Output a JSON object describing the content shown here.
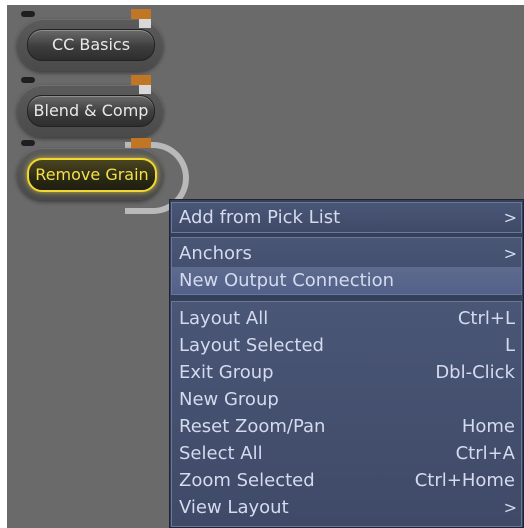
{
  "nodes": [
    {
      "label": "CC Basics",
      "selected": false
    },
    {
      "label": "Blend & Comp",
      "selected": false
    },
    {
      "label": "Remove Grain",
      "selected": true
    }
  ],
  "colors": {
    "canvas": "#6a6a6a",
    "menu_bg": "#343f5a",
    "menu_text": "#d4dbee",
    "selection_yellow": "#f1d834",
    "node_orange": "#c07624"
  },
  "menu": {
    "groups": [
      [
        {
          "label": "Add from Pick List",
          "shortcut": "",
          "submenu": true,
          "icon": "chevron-right-icon"
        }
      ],
      [
        {
          "label": "Anchors",
          "shortcut": "",
          "submenu": true,
          "icon": "chevron-right-icon"
        },
        {
          "label": "New Output Connection",
          "shortcut": "",
          "submenu": false,
          "highlighted": true
        }
      ],
      [
        {
          "label": "Layout All",
          "shortcut": "Ctrl+L",
          "submenu": false
        },
        {
          "label": "Layout Selected",
          "shortcut": "L",
          "submenu": false
        },
        {
          "label": "Exit Group",
          "shortcut": "Dbl-Click",
          "submenu": false
        },
        {
          "label": "New Group",
          "shortcut": "",
          "submenu": false
        },
        {
          "label": "Reset Zoom/Pan",
          "shortcut": "Home",
          "submenu": false
        },
        {
          "label": "Select All",
          "shortcut": "Ctrl+A",
          "submenu": false
        },
        {
          "label": "Zoom Selected",
          "shortcut": "Ctrl+Home",
          "submenu": false
        },
        {
          "label": "View Layout",
          "shortcut": "",
          "submenu": true,
          "icon": "chevron-right-icon"
        }
      ]
    ],
    "chevron_glyph": ">"
  }
}
